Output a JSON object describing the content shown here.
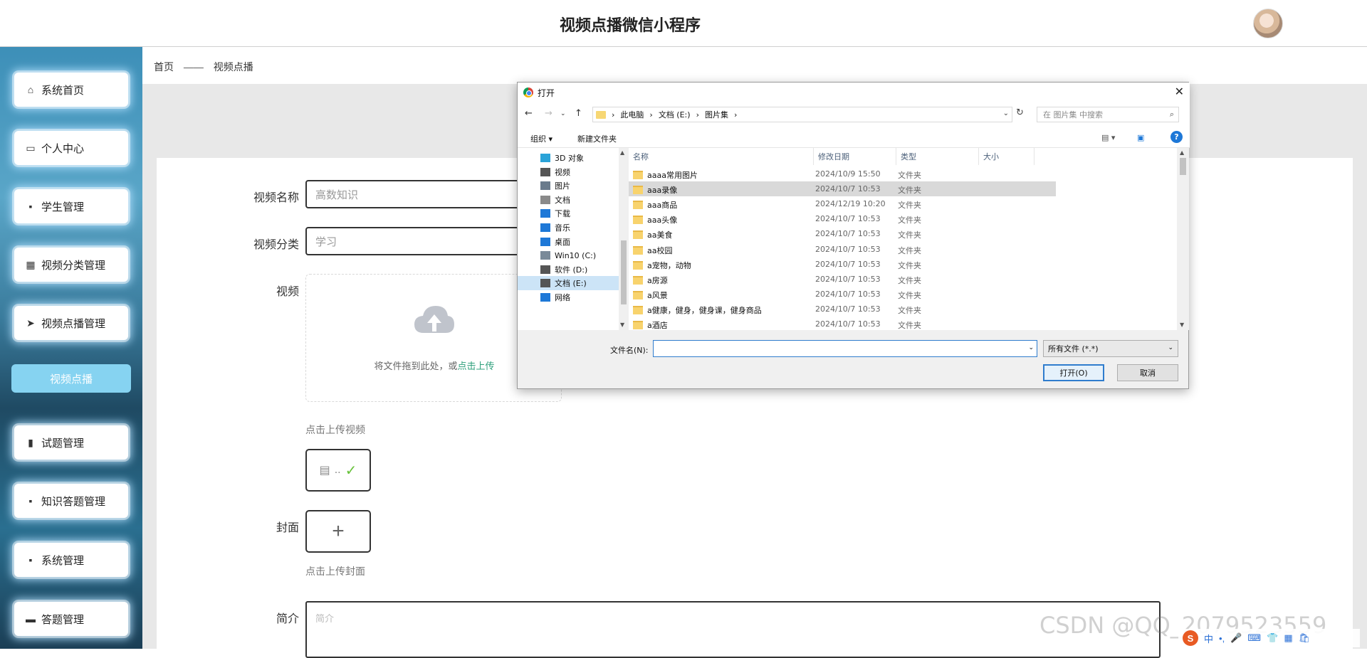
{
  "header": {
    "title": "视频点播微信小程序"
  },
  "sidebar": {
    "items": [
      {
        "label": "系统首页",
        "icon": "home-icon"
      },
      {
        "label": "个人中心",
        "icon": "id-card-icon"
      },
      {
        "label": "学生管理",
        "icon": "chat-icon"
      },
      {
        "label": "视频分类管理",
        "icon": "grid-icon"
      },
      {
        "label": "视频点播管理",
        "icon": "send-icon"
      },
      {
        "label": "视频点播",
        "icon": ""
      },
      {
        "label": "试题管理",
        "icon": "bar-chart-icon"
      },
      {
        "label": "知识答题管理",
        "icon": "apps-icon"
      },
      {
        "label": "系统管理",
        "icon": "apps-icon"
      },
      {
        "label": "答题管理",
        "icon": "briefcase-icon"
      }
    ]
  },
  "breadcrumb": {
    "home": "首页",
    "separator": "——",
    "current": "视频点播"
  },
  "form": {
    "name_label": "视频名称",
    "name_value": "高数知识",
    "category_label": "视频分类",
    "category_value": "学习",
    "video_label": "视频",
    "upload_text": "将文件拖到此处，或",
    "upload_link": "点击上传",
    "video_hint": "点击上传视频",
    "file_name": "..",
    "cover_label": "封面",
    "cover_hint": "点击上传封面",
    "intro_label": "简介",
    "intro_placeholder": "简介"
  },
  "watermark": "CSDN @QQ_2079523559",
  "tray": {
    "items": [
      "中",
      "•,",
      "🎤",
      "⌨",
      "👕",
      "▦",
      "🛍"
    ]
  },
  "dialog": {
    "title": "打开",
    "breadcrumb": [
      "此电脑",
      "文档 (E:)",
      "图片集"
    ],
    "search_placeholder": "在 图片集 中搜索",
    "organize": "组织 ▾",
    "new_folder": "新建文件夹",
    "nav_items": [
      {
        "label": "3D 对象",
        "color": "#2aa3d8"
      },
      {
        "label": "视频",
        "color": "#555555"
      },
      {
        "label": "图片",
        "color": "#6a7b8c"
      },
      {
        "label": "文档",
        "color": "#8a8a8a"
      },
      {
        "label": "下载",
        "color": "#1e78d7"
      },
      {
        "label": "音乐",
        "color": "#1e78d7"
      },
      {
        "label": "桌面",
        "color": "#1e78d7"
      },
      {
        "label": "Win10 (C:)",
        "color": "#7a8a99"
      },
      {
        "label": "软件 (D:)",
        "color": "#555555"
      },
      {
        "label": "文档 (E:)",
        "color": "#555555"
      },
      {
        "label": "网络",
        "color": "#1e78d7"
      }
    ],
    "columns": {
      "name": "名称",
      "date": "修改日期",
      "type": "类型",
      "size": "大小"
    },
    "files": [
      {
        "name": "aaaa常用图片",
        "date": "2024/10/9 15:50",
        "type": "文件夹"
      },
      {
        "name": "aaa录像",
        "date": "2024/10/7 10:53",
        "type": "文件夹"
      },
      {
        "name": "aaa商品",
        "date": "2024/12/19 10:20",
        "type": "文件夹"
      },
      {
        "name": "aaa头像",
        "date": "2024/10/7 10:53",
        "type": "文件夹"
      },
      {
        "name": "aa美食",
        "date": "2024/10/7 10:53",
        "type": "文件夹"
      },
      {
        "name": "aa校园",
        "date": "2024/10/7 10:53",
        "type": "文件夹"
      },
      {
        "name": "a宠物，动物",
        "date": "2024/10/7 10:53",
        "type": "文件夹"
      },
      {
        "name": "a房源",
        "date": "2024/10/7 10:53",
        "type": "文件夹"
      },
      {
        "name": "a风景",
        "date": "2024/10/7 10:53",
        "type": "文件夹"
      },
      {
        "name": "a健康，健身，健身课，健身商品",
        "date": "2024/10/7 10:53",
        "type": "文件夹"
      },
      {
        "name": "a酒店",
        "date": "2024/10/7 10:53",
        "type": "文件夹"
      }
    ],
    "filename_label": "文件名(N):",
    "filename_value": "",
    "filetype": "所有文件 (*.*)",
    "open_button": "打开(O)",
    "cancel_button": "取消"
  }
}
